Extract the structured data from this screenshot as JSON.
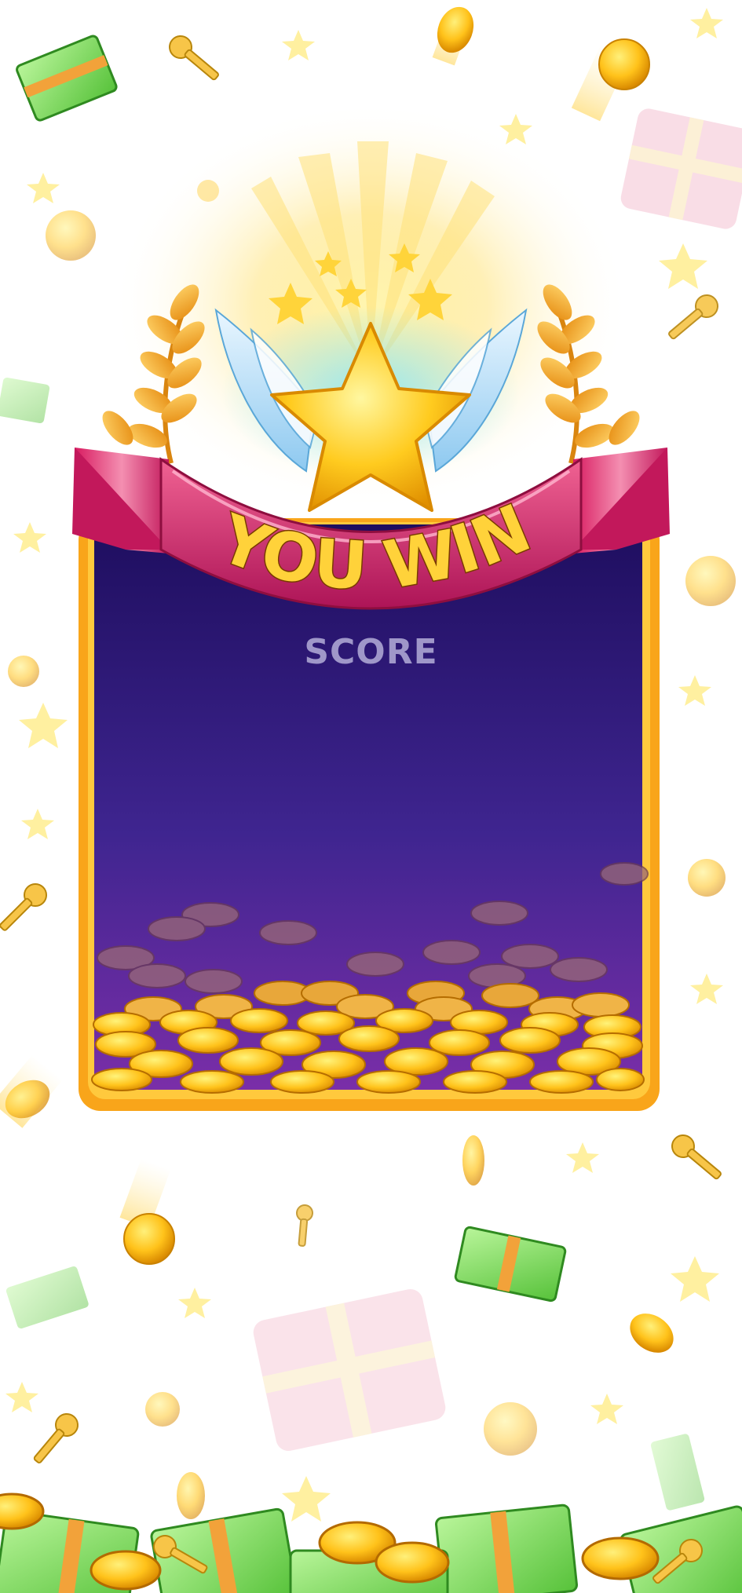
{
  "banner": {
    "title": "YOU WIN"
  },
  "panel": {
    "score_label": "SCORE"
  },
  "colors": {
    "panel_top": "#1e0e5f",
    "panel_bottom": "#7a2ea8",
    "frame": "#f9a51a",
    "ribbon": "#c2185b",
    "star": "#ffc800",
    "coin": "#ffc21a"
  },
  "icons": [
    "trophy-star-icon",
    "wings-icon",
    "laurel-icon",
    "ribbon-banner",
    "coin-icon",
    "key-icon",
    "cash-stack-icon",
    "treasure-chest-icon",
    "sparkle-star-icon"
  ]
}
